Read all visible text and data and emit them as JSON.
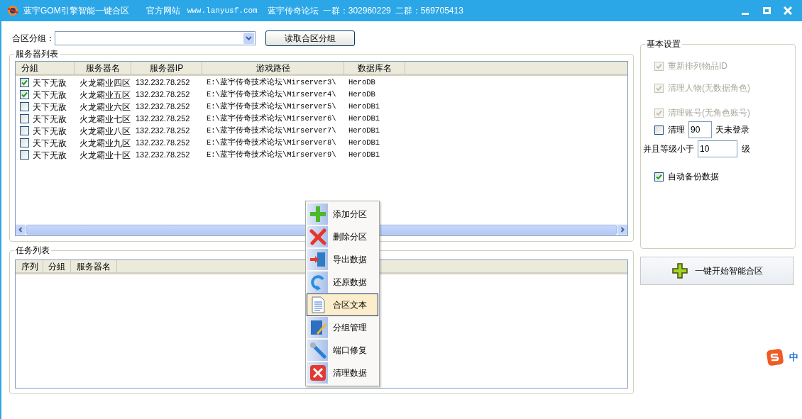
{
  "window": {
    "title": "蓝宇GOM引擎智能一键合区",
    "info": [
      "官方网站",
      "www.lanyusf.com",
      "蓝宇传奇论坛",
      "一群：302960229",
      "二群：569705413"
    ]
  },
  "group_select": {
    "label": "合区分组：",
    "button": "读取合区分组"
  },
  "server_list": {
    "title": "服务器列表",
    "columns": [
      "分組",
      "服务器名",
      "服务器IP",
      "游戏路径",
      "数据库名"
    ],
    "rows": [
      {
        "checked": true,
        "group": "天下无敌",
        "name": "火龙霸业四区",
        "ip": "132.232.78.252",
        "path": "E:\\蓝宇传奇技术论坛\\Mirserver3\\",
        "db": "HeroDB"
      },
      {
        "checked": true,
        "group": "天下无敌",
        "name": "火龙霸业五区",
        "ip": "132.232.78.252",
        "path": "E:\\蓝宇传奇技术论坛\\Mirserver4\\",
        "db": "HeroDB"
      },
      {
        "checked": false,
        "group": "天下无敌",
        "name": "火龙霸业六区",
        "ip": "132.232.78.252",
        "path": "E:\\蓝宇传奇技术论坛\\Mirserver5\\",
        "db": "HeroDB1"
      },
      {
        "checked": false,
        "group": "天下无敌",
        "name": "火龙霸业七区",
        "ip": "132.232.78.252",
        "path": "E:\\蓝宇传奇技术论坛\\Mirserver6\\",
        "db": "HeroDB1"
      },
      {
        "checked": false,
        "group": "天下无敌",
        "name": "火龙霸业八区",
        "ip": "132.232.78.252",
        "path": "E:\\蓝宇传奇技术论坛\\Mirserver7\\",
        "db": "HeroDB1"
      },
      {
        "checked": false,
        "group": "天下无敌",
        "name": "火龙霸业九区",
        "ip": "132.232.78.252",
        "path": "E:\\蓝宇传奇技术论坛\\Mirserver8\\",
        "db": "HeroDB1"
      },
      {
        "checked": false,
        "group": "天下无敌",
        "name": "火龙霸业十区",
        "ip": "132.232.78.252",
        "path": "E:\\蓝宇传奇技术论坛\\Mirserver9\\",
        "db": "HeroDB1"
      }
    ]
  },
  "task_list": {
    "title": "任务列表",
    "columns": [
      "序列",
      "分組",
      "服务器名"
    ]
  },
  "settings": {
    "title": "基本设置",
    "items": [
      {
        "kind": "checkbox",
        "label": "重新排列物品ID",
        "checked": true,
        "disabled": true
      },
      {
        "kind": "checkbox",
        "label": "清理人物(无数据角色)",
        "checked": true,
        "disabled": true
      },
      {
        "kind": "checkbox",
        "label": "清理账号(无角色账号)",
        "checked": true,
        "disabled": true
      },
      {
        "kind": "days",
        "label": "清理",
        "checked": false,
        "disabled": false,
        "value": "90",
        "suffix": "天未登录"
      },
      {
        "kind": "level",
        "label": "并且等级小于",
        "value": "10",
        "suffix": "级"
      },
      {
        "kind": "checkbox",
        "label": "自动备份数据",
        "checked": true,
        "disabled": false
      }
    ]
  },
  "start_button": "一键开始智能合区",
  "context_menu": [
    {
      "label": "添加分区",
      "selected": false
    },
    {
      "label": "删除分区",
      "selected": false
    },
    {
      "label": "导出数据",
      "selected": false
    },
    {
      "label": "还原数据",
      "selected": false
    },
    {
      "label": "合区文本",
      "selected": true
    },
    {
      "label": "分组管理",
      "selected": false
    },
    {
      "label": "端口修复",
      "selected": false
    },
    {
      "label": "清理数据",
      "selected": false
    }
  ],
  "ime_indicator": "中"
}
